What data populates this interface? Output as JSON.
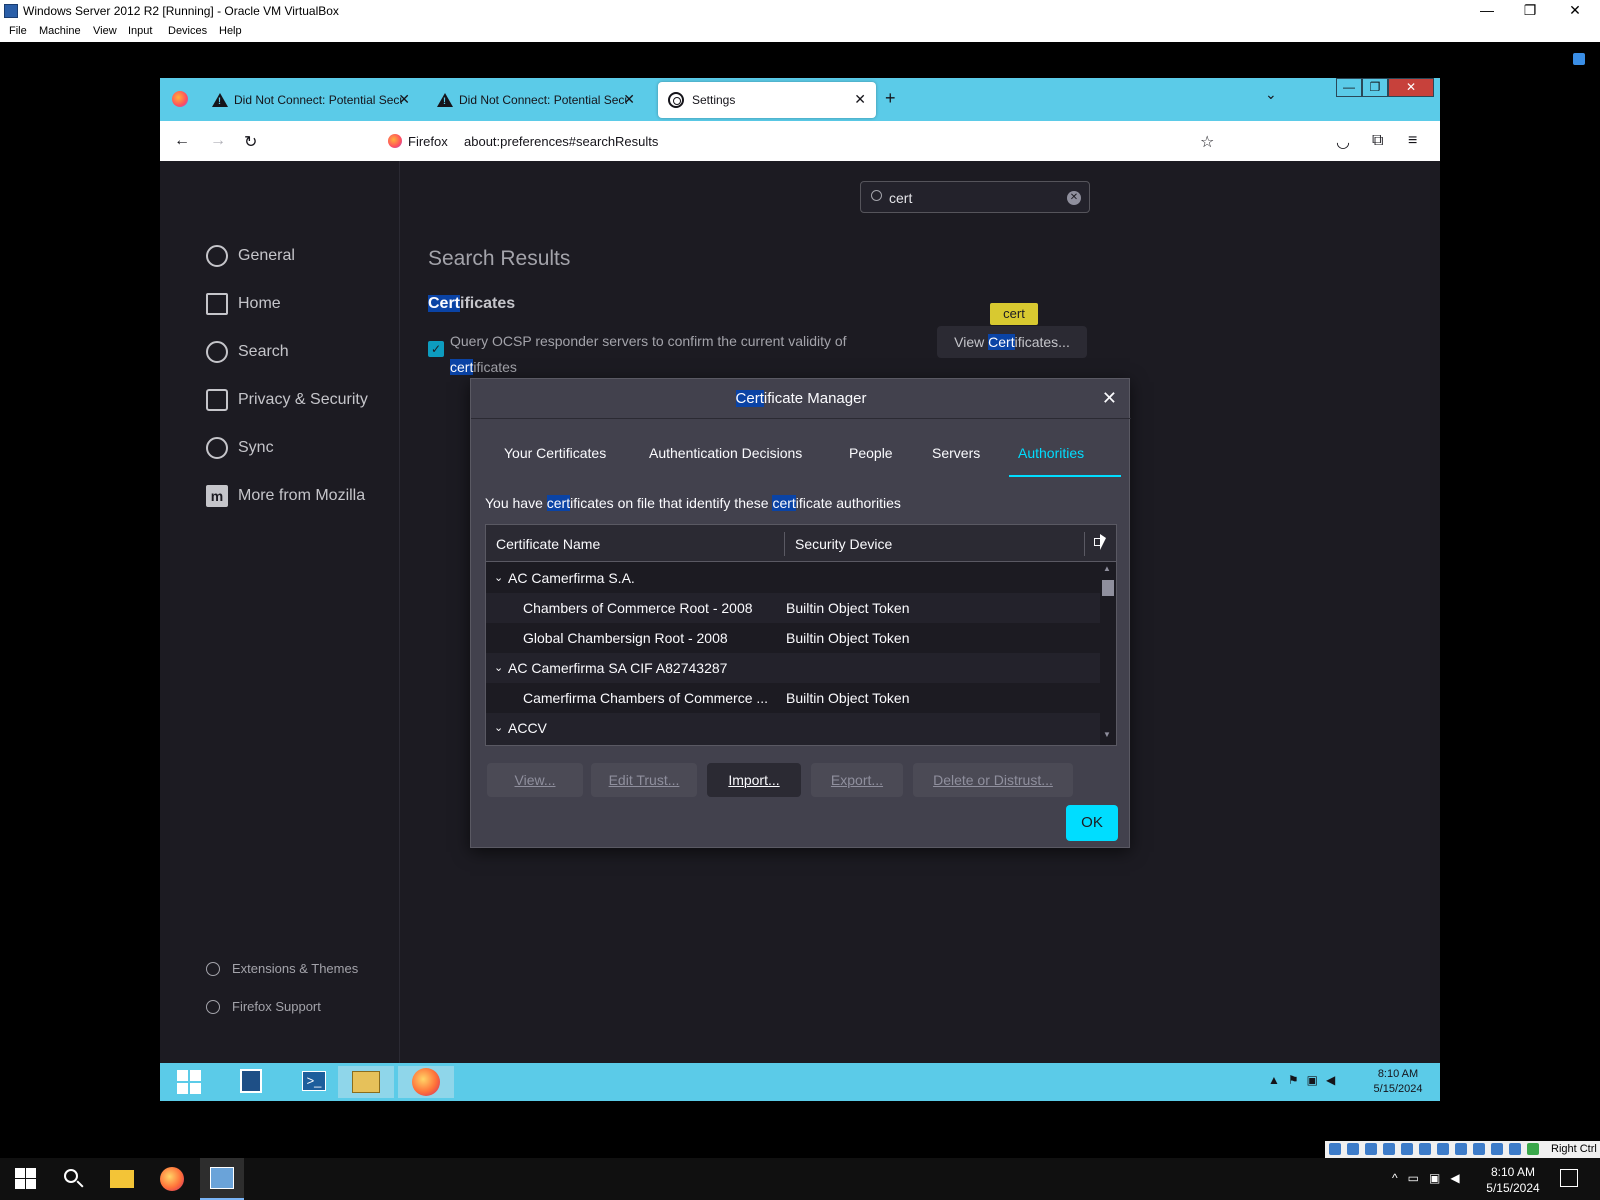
{
  "host": {
    "window_title": "Windows Server 2012 R2 [Running] - Oracle VM VirtualBox",
    "menu": [
      "File",
      "Machine",
      "View",
      "Input",
      "Devices",
      "Help"
    ],
    "status_right_ctrl": "Right Ctrl",
    "taskbar_time": "8:10 AM",
    "taskbar_date": "5/15/2024"
  },
  "browser": {
    "tabs": [
      {
        "label": "Did Not Connect: Potential Security Issue",
        "icon": "warning-icon"
      },
      {
        "label": "Did Not Connect: Potential Security Issue",
        "icon": "warning-icon"
      },
      {
        "label": "Settings",
        "icon": "gear-icon",
        "active": true
      }
    ],
    "identity_label": "Firefox",
    "url": "about:preferences#searchResults"
  },
  "prefs": {
    "nav": [
      "General",
      "Home",
      "Search",
      "Privacy & Security",
      "Sync",
      "More from Mozilla"
    ],
    "footer_nav": [
      "Extensions & Themes",
      "Firefox Support"
    ],
    "search_value": "cert",
    "results_title": "Search Results",
    "section_heading_hl": "Cert",
    "section_heading_rest": "ificates",
    "ocsp_text_1": "Query OCSP responder servers to confirm the current validity of",
    "ocsp_hl": "cert",
    "ocsp_text_2": "ificates",
    "view_btn_1": "View ",
    "view_btn_hl": "Cert",
    "view_btn_2": "ificates...",
    "tooltip": "cert"
  },
  "dialog": {
    "title_hl": "Cert",
    "title_rest": "ificate Manager",
    "tabs": [
      "Your Certificates",
      "Authentication Decisions",
      "People",
      "Servers",
      "Authorities"
    ],
    "active_tab": "Authorities",
    "desc_1": "You have ",
    "desc_hl1": "cert",
    "desc_2": "ificates on file that identify these ",
    "desc_hl2": "cert",
    "desc_3": "ificate authorities",
    "col_name": "Certificate Name",
    "col_device": "Security Device",
    "rows": [
      {
        "type": "group",
        "name": "AC Camerfirma S.A."
      },
      {
        "type": "cert",
        "name": "Chambers of Commerce Root - 2008",
        "device": "Builtin Object Token"
      },
      {
        "type": "cert",
        "name": "Global Chambersign Root - 2008",
        "device": "Builtin Object Token"
      },
      {
        "type": "group",
        "name": "AC Camerfirma SA CIF A82743287"
      },
      {
        "type": "cert",
        "name": "Camerfirma Chambers of Commerce ...",
        "device": "Builtin Object Token"
      },
      {
        "type": "group",
        "name": "ACCV"
      }
    ],
    "buttons": {
      "view": "View...",
      "edit_trust": "Edit Trust...",
      "import": "Import...",
      "export": "Export...",
      "delete": "Delete or Distrust...",
      "ok": "OK"
    }
  },
  "guest_taskbar": {
    "time": "8:10 AM",
    "date": "5/15/2024"
  }
}
